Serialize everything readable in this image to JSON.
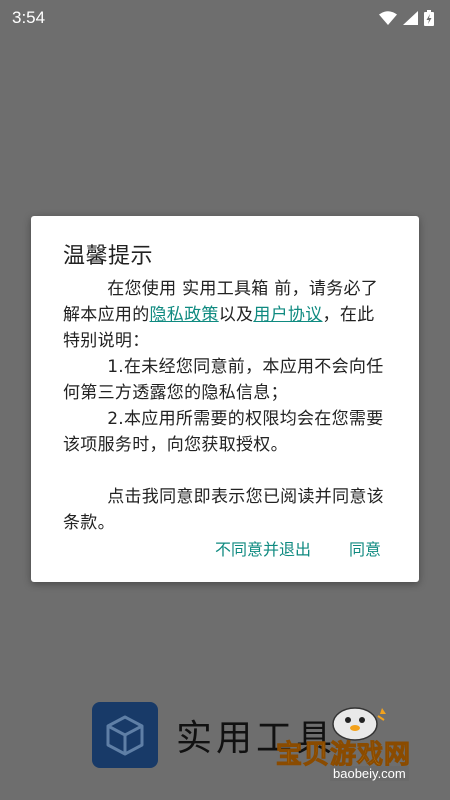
{
  "status_bar": {
    "time": "3:54"
  },
  "dialog": {
    "title": "温馨提示",
    "para1_pre": "在您使用 实用工具箱 前，请务必了解本应用的",
    "privacy_link": "隐私政策",
    "para1_mid": "以及",
    "user_link": "用户协议",
    "para1_post": "，在此特别说明：",
    "item1": "1.在未经您同意前，本应用不会向任何第三方透露您的隐私信息；",
    "item2": "2.本应用所需要的权限均会在您需要该项服务时，向您获取授权。",
    "para2": "点击我同意即表示您已阅读并同意该条款。",
    "decline_button": "不同意并退出",
    "agree_button": "同意",
    "accent_color": "#0f8a80"
  },
  "splash": {
    "app_name": "实用工具",
    "icon": "cube-icon"
  },
  "watermark": {
    "text": "宝贝游戏网",
    "domain": "baobeiy.com",
    "icon": "gamepad-penguin-icon"
  }
}
